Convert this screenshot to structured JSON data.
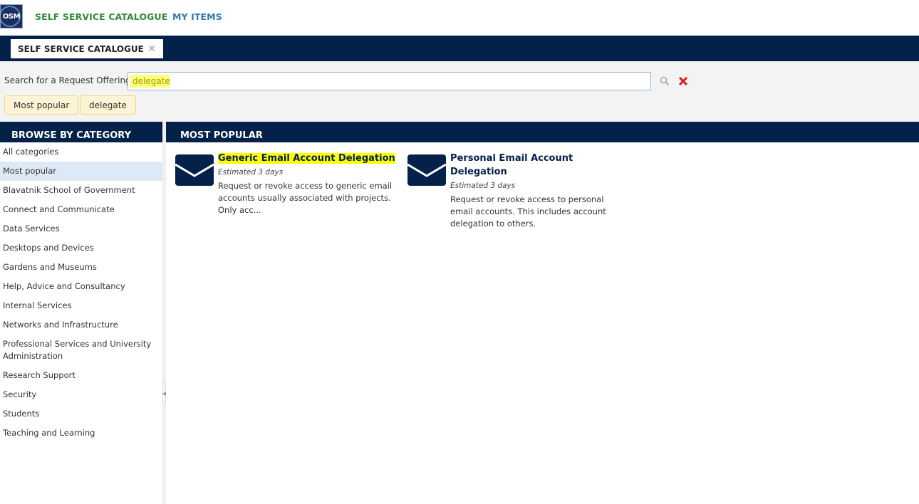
{
  "topnav": {
    "logo_text": "OSM",
    "links": [
      {
        "label": "SELF SERVICE CATALOGUE",
        "active": true
      },
      {
        "label": "MY ITEMS",
        "active": false
      }
    ]
  },
  "tabs": [
    {
      "label": "SELF SERVICE CATALOGUE",
      "close_icon": "×"
    }
  ],
  "search": {
    "label": "Search for a Request Offering:",
    "value": "delegate",
    "placeholder": "",
    "search_icon": "🔍",
    "clear_icon": "✕"
  },
  "chips": [
    {
      "label": "Most popular"
    },
    {
      "label": "delegate"
    }
  ],
  "sidebar": {
    "title": "BROWSE BY CATEGORY",
    "items": [
      {
        "label": "All categories"
      },
      {
        "label": "Most popular",
        "selected": true
      },
      {
        "label": "Blavatnik School of Government"
      },
      {
        "label": "Connect and Communicate"
      },
      {
        "label": "Data Services"
      },
      {
        "label": "Desktops and Devices"
      },
      {
        "label": "Gardens and Museums"
      },
      {
        "label": "Help, Advice and Consultancy"
      },
      {
        "label": "Internal Services"
      },
      {
        "label": "Networks and Infrastructure"
      },
      {
        "label": "Professional Services and University Administration"
      },
      {
        "label": "Research Support"
      },
      {
        "label": "Security"
      },
      {
        "label": "Students"
      },
      {
        "label": "Teaching and Learning"
      }
    ]
  },
  "main": {
    "title": "MOST POPULAR",
    "offerings": [
      {
        "icon": "envelope-icon",
        "title": "Generic Email Account Delegation",
        "estimate": "Estimated 3 days",
        "description": "Request or revoke access to generic email accounts usually associated with projects. Only acc..."
      },
      {
        "icon": "envelope-icon",
        "title": "Personal Email Account Delegation",
        "estimate": "Estimated 3 days",
        "description": "Request or revoke access to personal email accounts. This includes account delegation to others."
      }
    ]
  },
  "colors": {
    "navy": "#04214a",
    "highlight": "#ffff00",
    "link_blue": "#2b7ab5",
    "clear_red": "#e01616",
    "chip_bg": "#fdf3d5",
    "selected_bg": "#dde9f7"
  }
}
